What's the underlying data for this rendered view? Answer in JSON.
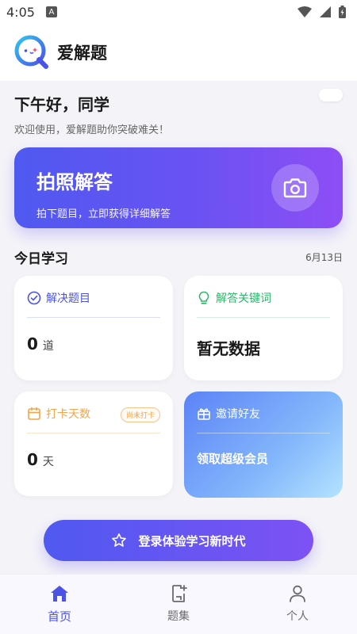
{
  "status_bar": {
    "time": "4:05",
    "indicator": "A"
  },
  "header": {
    "app_name": "爱解题"
  },
  "greeting": {
    "title": "下午好，同学",
    "subtitle": "欢迎使用，爱解题助你突破难关！"
  },
  "hero": {
    "title": "拍照解答",
    "subtitle": "拍下题目，立即获得详细解答",
    "icon": "camera-icon"
  },
  "today": {
    "title": "今日学习",
    "date": "6月13日",
    "solved": {
      "label": "解决题目",
      "value": "0",
      "unit": "道",
      "icon": "check-circle-icon",
      "color": "#4b52e8"
    },
    "keywords": {
      "label": "解答关键词",
      "value": "暂无数据",
      "icon": "lightbulb-icon",
      "color": "#2fb56a"
    },
    "checkin": {
      "label": "打卡天数",
      "badge": "尚未打卡",
      "value": "0",
      "unit": "天",
      "icon": "calendar-icon",
      "color": "#f0a64a"
    },
    "invite": {
      "label": "邀请好友",
      "cta": "领取超级会员",
      "icon": "gift-icon"
    }
  },
  "login_button": {
    "label": "登录体验学习新时代",
    "icon": "star-icon"
  },
  "bottom_nav": [
    {
      "label": "首页",
      "icon": "home-icon",
      "active": true
    },
    {
      "label": "题集",
      "icon": "question-set-icon",
      "active": false
    },
    {
      "label": "个人",
      "icon": "person-icon",
      "active": false
    }
  ],
  "colors": {
    "accent": "#4b52e8",
    "gradient_end": "#8e4ef6",
    "success": "#2fb56a",
    "warning": "#f0a64a"
  }
}
